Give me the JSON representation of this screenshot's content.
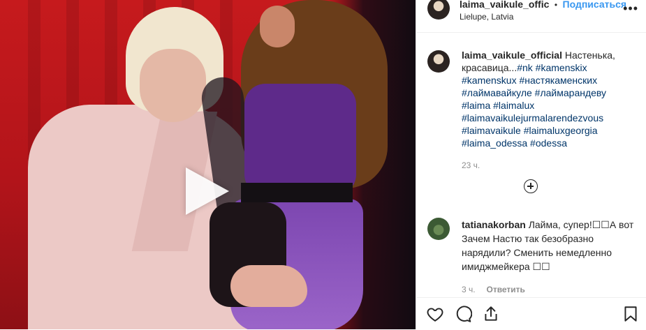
{
  "post": {
    "username": "laima_vaikule_offic",
    "separator": "•",
    "follow_label": "Подписаться",
    "location": "Lielupe, Latvia",
    "more_label": "•••"
  },
  "caption": {
    "username": "laima_vaikule_official",
    "text": " Настенька, красавица...",
    "hashtags": "#nk #kamenskix #kamenskux #настякаменских #лаймавайкуле #лаймарандеву #laima #laimalux #laimavaikulejurmalarendezvous #laimavaikule #laimaluxgeorgia #laima_odessa #odessa",
    "time": "23 ч."
  },
  "comment": {
    "username": "tatianakorban",
    "text": " Лайма, супер!☐☐А вот Зачем Настю так безобразно нарядили? Сменить немедленно имиджмейкера ☐☐",
    "time": "3 ч.",
    "reply_label": "Ответить"
  },
  "icons": {
    "play": "play-icon",
    "more": "more-options-icon",
    "load_more": "plus-circle-icon",
    "like": "heart-icon",
    "comment": "comment-icon",
    "share": "share-icon",
    "save": "bookmark-icon"
  },
  "colors": {
    "follow": "#3897f0",
    "text": "#262626",
    "muted": "#8e8e8e",
    "hashtag": "#003569",
    "video_bg": "#c61a1d"
  }
}
